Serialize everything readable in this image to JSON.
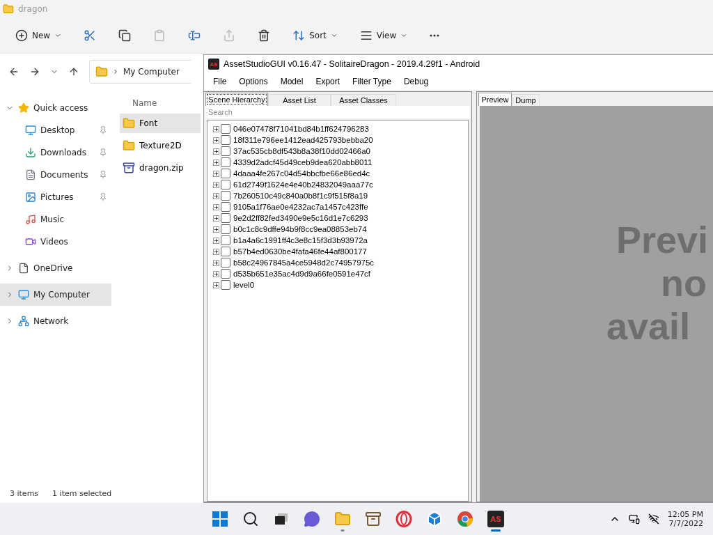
{
  "explorer": {
    "title": "dragon",
    "toolbar": [
      {
        "kind": "new",
        "label": "New",
        "disabled": false
      },
      {
        "kind": "cut",
        "disabled": false
      },
      {
        "kind": "copy",
        "disabled": false
      },
      {
        "kind": "paste",
        "disabled": true
      },
      {
        "kind": "rename",
        "disabled": false
      },
      {
        "kind": "share",
        "disabled": true
      },
      {
        "kind": "delete",
        "disabled": false
      },
      {
        "kind": "sort",
        "label": "Sort",
        "disabled": false
      },
      {
        "kind": "view",
        "label": "View",
        "disabled": false
      },
      {
        "kind": "more",
        "disabled": false
      }
    ],
    "breadcrumb": [
      "My Computer"
    ],
    "nav": [
      {
        "label": "Quick access",
        "kind": "star",
        "expanded": true,
        "selected": false,
        "children": [
          {
            "label": "Desktop",
            "kind": "desktop",
            "pinned": true
          },
          {
            "label": "Downloads",
            "kind": "download",
            "pinned": true
          },
          {
            "label": "Documents",
            "kind": "document",
            "pinned": true
          },
          {
            "label": "Pictures",
            "kind": "picture",
            "pinned": true
          },
          {
            "label": "Music",
            "kind": "music",
            "pinned": false
          },
          {
            "label": "Videos",
            "kind": "video",
            "pinned": false
          }
        ]
      },
      {
        "label": "OneDrive",
        "kind": "file",
        "expanded": false,
        "selected": false
      },
      {
        "label": "My Computer",
        "kind": "computer",
        "expanded": false,
        "selected": true
      },
      {
        "label": "Network",
        "kind": "network",
        "expanded": false,
        "selected": false
      }
    ],
    "column": "Name",
    "files": [
      {
        "name": "Font",
        "kind": "folder",
        "selected": true
      },
      {
        "name": "Texture2D",
        "kind": "folder",
        "selected": false
      },
      {
        "name": "dragon.zip",
        "kind": "zip",
        "selected": false
      }
    ],
    "status": [
      "3 items",
      "1 item selected"
    ]
  },
  "asset_studio": {
    "logo": "AS",
    "title": "AssetStudioGUI v0.16.47 - SolitaireDragon - 2019.4.29f1 - Android",
    "menu": [
      "File",
      "Options",
      "Model",
      "Export",
      "Filter Type",
      "Debug"
    ],
    "left_tabs": [
      {
        "label": "Scene Hierarchy",
        "selected": true
      },
      {
        "label": "Asset List",
        "selected": false
      },
      {
        "label": "Asset Classes",
        "selected": false
      }
    ],
    "search": {
      "placeholder": "Search"
    },
    "tree": [
      {
        "label": "046e07478f71041bd84b1ff624796283",
        "expanded": false,
        "checked": false
      },
      {
        "label": "18f311e796ee1412ead425793bebba20",
        "expanded": false,
        "checked": false
      },
      {
        "label": "37ac535cb8df543b8a38f10dd02466a0",
        "expanded": false,
        "checked": false
      },
      {
        "label": "4339d2adcf45d49ceb9dea620abb8011",
        "expanded": false,
        "checked": false
      },
      {
        "label": "4daaa4fe267c04d54bbcfbe66e86ed4c",
        "expanded": false,
        "checked": false
      },
      {
        "label": "61d2749f1624e4e40b24832049aaa77c",
        "expanded": false,
        "checked": false
      },
      {
        "label": "7b260510c49c840a0b8f1c9f515f8a19",
        "expanded": false,
        "checked": false
      },
      {
        "label": "9105a1f76ae0e4232ac7a1457c423ffe",
        "expanded": false,
        "checked": false
      },
      {
        "label": "9e2d2ff82fed3490e9e5c16d1e7c6293",
        "expanded": false,
        "checked": false
      },
      {
        "label": "b0c1c8c9dffe94b9f8cc9ea08853eb74",
        "expanded": false,
        "checked": false
      },
      {
        "label": "b1a4a6c1991ff4c3e8c15f3d3b93972a",
        "expanded": false,
        "checked": false
      },
      {
        "label": "b57b4ed0630be4fafa46fe44af800177",
        "expanded": false,
        "checked": false
      },
      {
        "label": "b58c24967845a4ce5948d2c74957975c",
        "expanded": false,
        "checked": false
      },
      {
        "label": "d535b651e35ac4d9d9a66fe0591e47cf",
        "expanded": false,
        "checked": false
      },
      {
        "label": "level0",
        "expanded": false,
        "checked": false
      }
    ],
    "right_tabs": [
      {
        "label": "Preview",
        "selected": true
      },
      {
        "label": "Dump",
        "selected": false
      }
    ],
    "preview_lines": [
      "Previ",
      "no",
      "avail"
    ]
  },
  "taskbar": {
    "apps": [
      {
        "kind": "start",
        "active": false,
        "running": false
      },
      {
        "kind": "search",
        "active": false,
        "running": false
      },
      {
        "kind": "taskview",
        "active": false,
        "running": false
      },
      {
        "kind": "chat",
        "active": false,
        "running": false
      },
      {
        "kind": "explorer",
        "active": false,
        "running": true
      },
      {
        "kind": "archive",
        "active": false,
        "running": false
      },
      {
        "kind": "opera",
        "active": false,
        "running": false
      },
      {
        "kind": "box",
        "active": false,
        "running": false
      },
      {
        "kind": "chrome",
        "active": false,
        "running": false
      },
      {
        "kind": "assetstudio",
        "label": "AS",
        "active": true,
        "running": true
      }
    ],
    "time": "12:05 PM",
    "date": "7/7/2022"
  }
}
